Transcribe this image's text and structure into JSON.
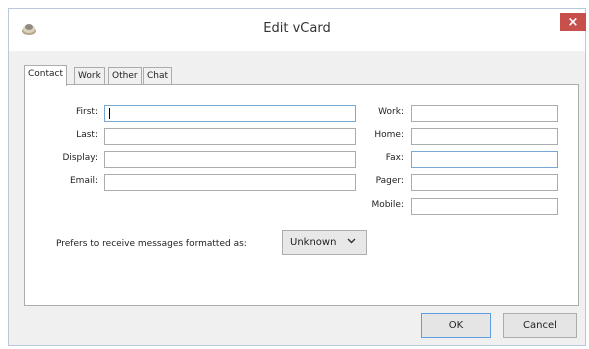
{
  "window": {
    "title": "Edit vCard",
    "close_label": "×"
  },
  "tabs": [
    {
      "label": "Contact",
      "active": true
    },
    {
      "label": "Work",
      "active": false
    },
    {
      "label": "Other",
      "active": false
    },
    {
      "label": "Chat",
      "active": false
    }
  ],
  "contact": {
    "first_label": "First:",
    "first_value": "",
    "last_label": "Last:",
    "last_value": "",
    "display_label": "Display:",
    "display_value": "",
    "email_label": "Email:",
    "email_value": "",
    "work_label": "Work:",
    "work_value": "",
    "home_label": "Home:",
    "home_value": "",
    "fax_label": "Fax:",
    "fax_value": "",
    "pager_label": "Pager:",
    "pager_value": "",
    "mobile_label": "Mobile:",
    "mobile_value": ""
  },
  "format": {
    "label": "Prefers to receive messages formatted as:",
    "selected": "Unknown"
  },
  "buttons": {
    "ok_label": "OK",
    "cancel_label": "Cancel"
  },
  "colors": {
    "close_button": "#c7504d",
    "focus_border": "#7aa9d8"
  }
}
